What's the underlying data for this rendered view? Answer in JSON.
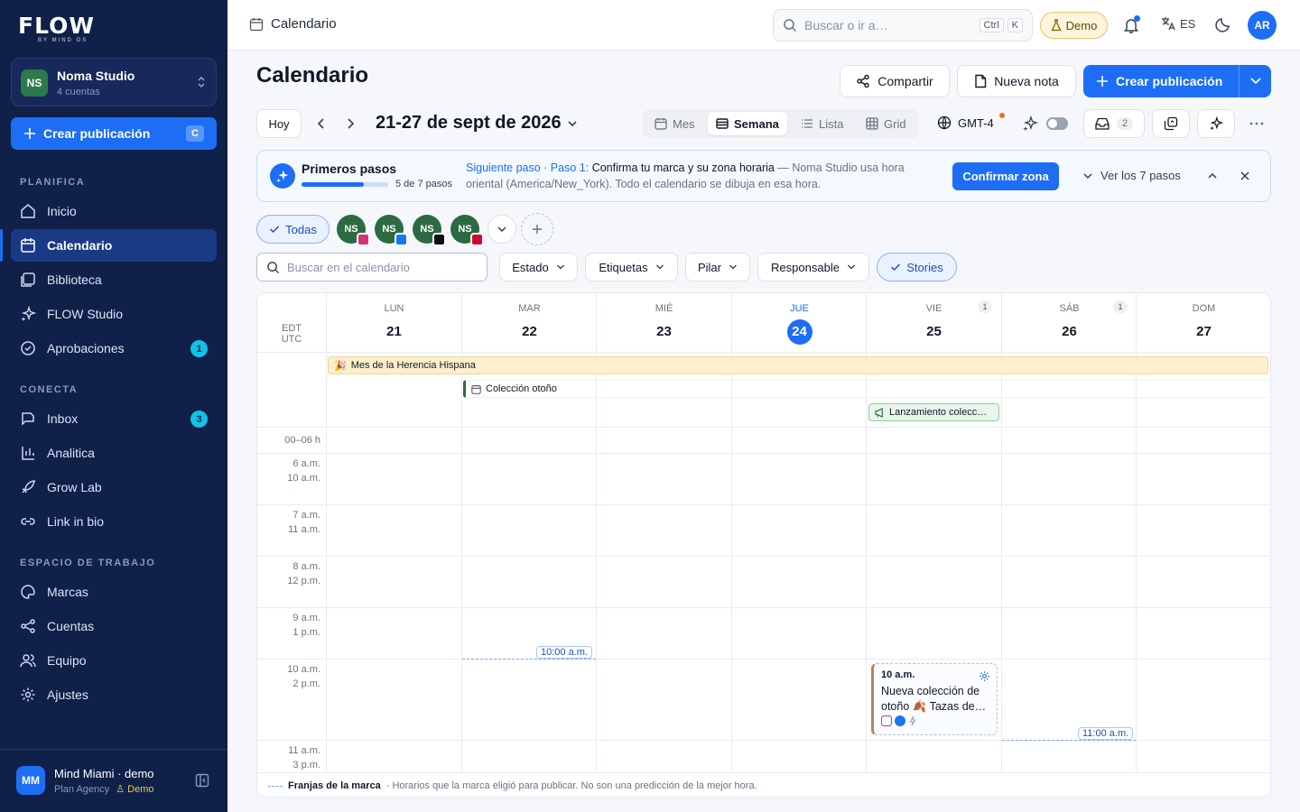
{
  "sidebar": {
    "logo": "FLOW",
    "logo_sub": "BY MIND OS",
    "org": {
      "initials": "NS",
      "name": "Noma Studio",
      "count": "4 cuentas"
    },
    "create": {
      "label": "Crear publicación",
      "shortcut": "C"
    },
    "sections": [
      {
        "title": "PLANIFICA",
        "items": [
          {
            "label": "Inicio",
            "icon": "home-icon"
          },
          {
            "label": "Calendario",
            "icon": "calendar-icon",
            "active": true
          },
          {
            "label": "Biblioteca",
            "icon": "library-icon"
          },
          {
            "label": "FLOW Studio",
            "icon": "sparkle-icon"
          },
          {
            "label": "Aprobaciones",
            "icon": "check-circle-icon",
            "badge": "1"
          }
        ]
      },
      {
        "title": "CONECTA",
        "items": [
          {
            "label": "Inbox",
            "icon": "inbox-icon",
            "badge": "3"
          },
          {
            "label": "Analitica",
            "icon": "bar-chart-icon"
          },
          {
            "label": "Grow Lab",
            "icon": "rocket-icon"
          },
          {
            "label": "Link in bio",
            "icon": "link-icon"
          }
        ]
      },
      {
        "title": "ESPACIO DE TRABAJO",
        "items": [
          {
            "label": "Marcas",
            "icon": "palette-icon"
          },
          {
            "label": "Cuentas",
            "icon": "share-icon"
          },
          {
            "label": "Equipo",
            "icon": "users-icon"
          },
          {
            "label": "Ajustes",
            "icon": "gear-icon"
          }
        ]
      }
    ],
    "footer": {
      "initials": "MM",
      "name": "Mind Miami · demo",
      "plan": "Plan Agency",
      "demo": "Demo"
    }
  },
  "topbar": {
    "title": "Calendario",
    "search_placeholder": "Buscar o ir a…",
    "kbd1": "Ctrl",
    "kbd2": "K",
    "demo": "Demo",
    "lang": "ES",
    "user_initials": "AR"
  },
  "page": {
    "title": "Calendario",
    "share": "Compartir",
    "new_note": "Nueva nota",
    "create": "Crear publicación",
    "today": "Hoy",
    "period": "21-27 de sept de 2026",
    "views": [
      "Mes",
      "Semana",
      "Lista",
      "Grid"
    ],
    "active_view": "Semana",
    "timezone": "GMT-4",
    "inbox_count": "2"
  },
  "onboarding": {
    "title": "Primeros pasos",
    "progress": 0.714,
    "steps": "5 de 7 pasos",
    "next_label": "Siguiente paso · Paso 1:",
    "next_title": "Confirma tu marca y su zona horaria",
    "next_desc": "— Noma Studio usa hora oriental (America/New_York). Todo el calendario se dibuja en esa hora.",
    "confirm": "Confirmar zona",
    "view_steps": "Ver los 7 pasos"
  },
  "accounts": {
    "all": "Todas",
    "list": [
      {
        "initials": "NS",
        "network": "instagram",
        "color": "#d6336c"
      },
      {
        "initials": "NS",
        "network": "facebook",
        "color": "#1877f2"
      },
      {
        "initials": "NS",
        "network": "tiktok",
        "color": "#111111"
      },
      {
        "initials": "NS",
        "network": "pinterest",
        "color": "#c8102e"
      }
    ]
  },
  "filters": {
    "search_placeholder": "Buscar en el calendario",
    "items": [
      "Estado",
      "Etiquetas",
      "Pilar",
      "Responsable"
    ],
    "stories": "Stories"
  },
  "calendar": {
    "tz_labels": [
      "EDT",
      "UTC"
    ],
    "days": [
      {
        "name": "LUN",
        "num": "21"
      },
      {
        "name": "MAR",
        "num": "22"
      },
      {
        "name": "MIÉ",
        "num": "23"
      },
      {
        "name": "JUE",
        "num": "24",
        "today": true
      },
      {
        "name": "VIE",
        "num": "25",
        "count": "1"
      },
      {
        "name": "SÁB",
        "num": "26",
        "count": "1"
      },
      {
        "name": "DOM",
        "num": "27"
      }
    ],
    "allday": [
      {
        "label": "Mes de la Herencia Hispana"
      },
      {
        "label": "Colección otoño"
      },
      {
        "label": "Lanzamiento colecc…"
      }
    ],
    "night_label": "00–06 h",
    "hours": [
      {
        "edt": "6 a.m.",
        "utc": "10 a.m."
      },
      {
        "edt": "7 a.m.",
        "utc": "11 a.m."
      },
      {
        "edt": "8 a.m.",
        "utc": "12 p.m."
      },
      {
        "edt": "9 a.m.",
        "utc": "1 p.m."
      },
      {
        "edt": "10 a.m.",
        "utc": "2 p.m."
      },
      {
        "edt": "11 a.m.",
        "utc": "3 p.m."
      }
    ],
    "slots": [
      "10:00 a.m.",
      "11:00 a.m."
    ],
    "event": {
      "time": "10 a.m.",
      "text": "Nueva colección de otoño 🍂 Tazas de…"
    },
    "legend_title": "Franjas de la marca",
    "legend_text": "· Horarios que la marca eligió para publicar. No son una predicción de la mejor hora."
  }
}
